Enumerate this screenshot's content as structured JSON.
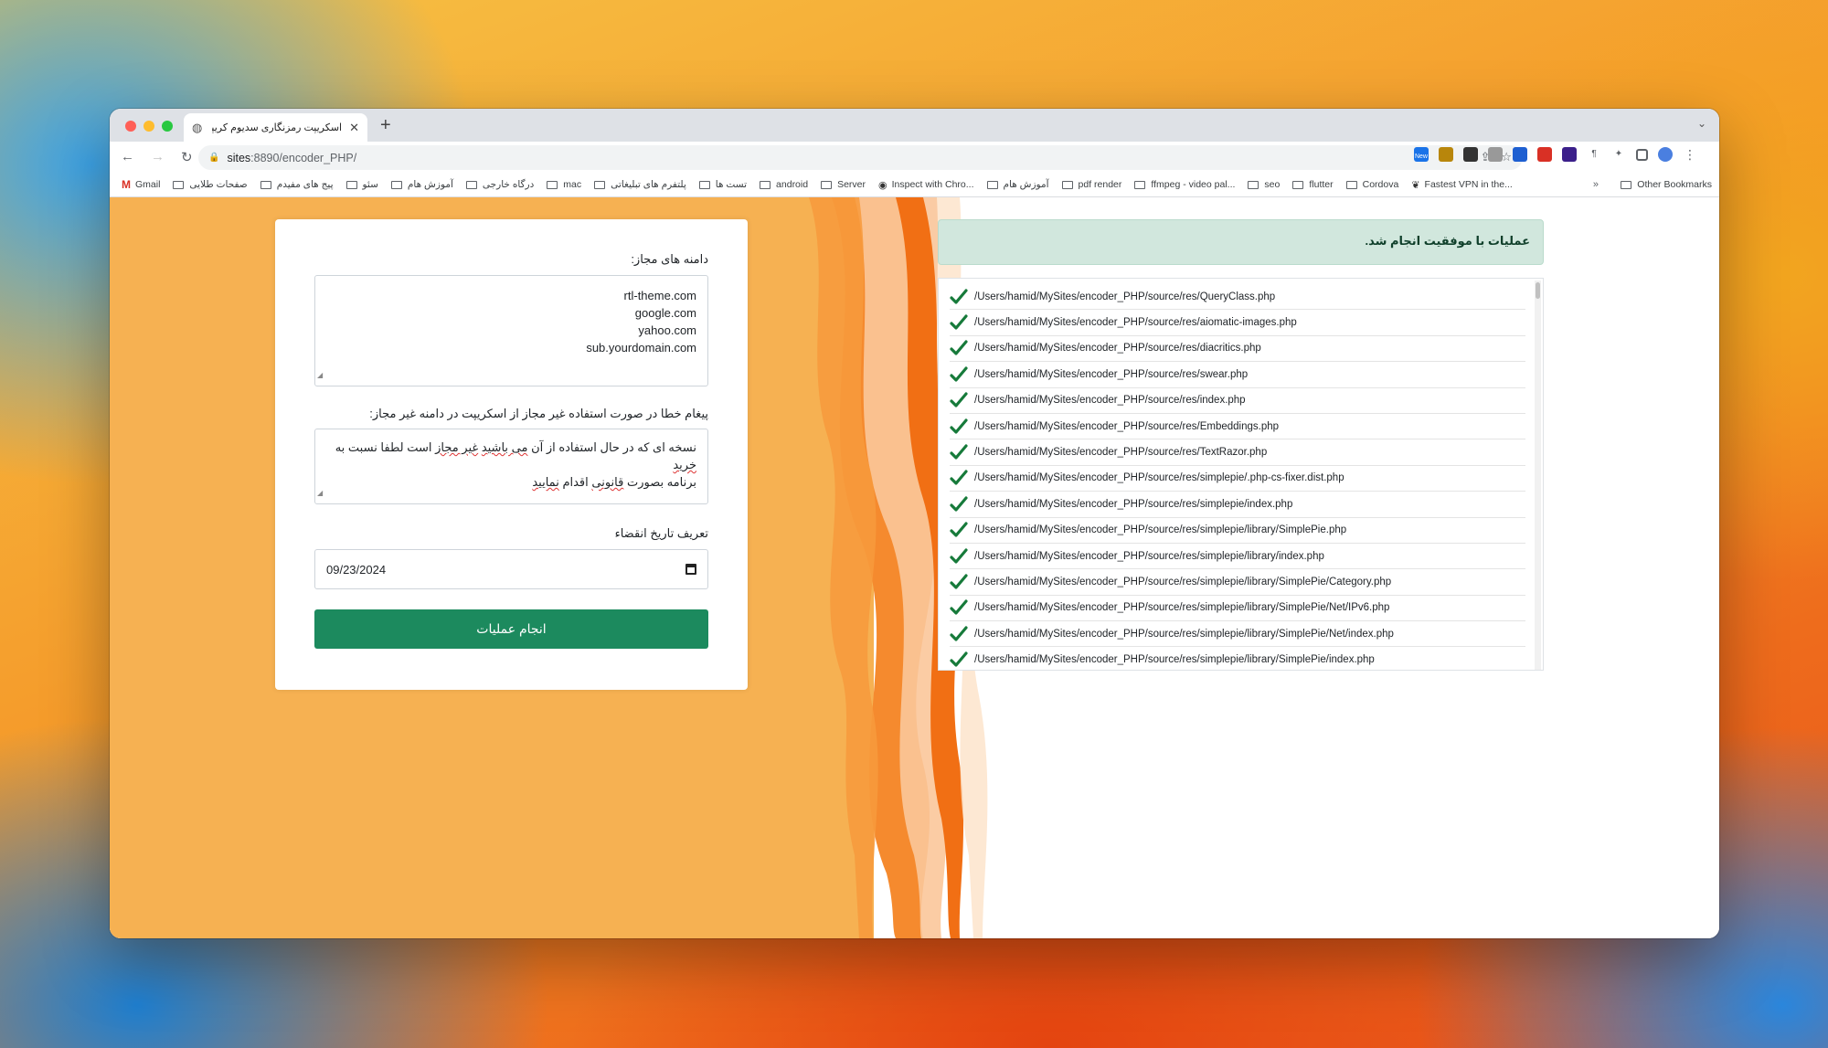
{
  "browser": {
    "tab_title": "اسکریپت رمزنگاری سدیوم کریپتو",
    "url_host": "sites",
    "url_rest": ":8890/encoder_PHP/",
    "bookmarks": [
      "Gmail",
      "صفحات طلایی",
      "پیج های مفیدم",
      "سئو",
      "آموزش هام",
      "درگاه خارجی",
      "mac",
      "پلتفرم های تبلیغاتی",
      "تست ها",
      "android",
      "Server",
      "Inspect with Chro...",
      "آموزش هام",
      "pdf render",
      "ffmpeg - video pal...",
      "seo",
      "flutter",
      "Cordova",
      "Fastest VPN in the..."
    ],
    "bookmarks_more": "»",
    "other_bookmarks": "Other Bookmarks",
    "ext_badge": "New"
  },
  "form": {
    "domains_label": "دامنه های مجاز:",
    "domains": [
      "rtl-theme.com",
      "google.com",
      "yahoo.com",
      "sub.yourdomain.com"
    ],
    "error_label": "پیغام خطا در صورت استفاده غیر مجاز از اسکریپت در دامنه غیر مجاز:",
    "error_line1_a": "نسخه ای که در حال استفاده از آن ",
    "error_line1_u1": "می باشید",
    "error_line1_b": " ",
    "error_line1_u2": "غیر مجاز",
    "error_line1_c": " است لطفا نسبت به ",
    "error_line1_u3": "خرید",
    "error_line2_a": "برنامه بصورت ",
    "error_line2_u1": "قانونی",
    "error_line2_b": " اقدام ",
    "error_line2_u2": "نمایید",
    "expiry_label": "تعریف تاریخ انقضاء",
    "expiry_value": "09/23/2024",
    "submit_label": "انجام عملیات"
  },
  "result": {
    "success_message": "عملیات با موفقیت انجام شد.",
    "files": [
      "/Users/hamid/MySites/encoder_PHP/source/res/QueryClass.php",
      "/Users/hamid/MySites/encoder_PHP/source/res/aiomatic-images.php",
      "/Users/hamid/MySites/encoder_PHP/source/res/diacritics.php",
      "/Users/hamid/MySites/encoder_PHP/source/res/swear.php",
      "/Users/hamid/MySites/encoder_PHP/source/res/index.php",
      "/Users/hamid/MySites/encoder_PHP/source/res/Embeddings.php",
      "/Users/hamid/MySites/encoder_PHP/source/res/TextRazor.php",
      "/Users/hamid/MySites/encoder_PHP/source/res/simplepie/.php-cs-fixer.dist.php",
      "/Users/hamid/MySites/encoder_PHP/source/res/simplepie/index.php",
      "/Users/hamid/MySites/encoder_PHP/source/res/simplepie/library/SimplePie.php",
      "/Users/hamid/MySites/encoder_PHP/source/res/simplepie/library/index.php",
      "/Users/hamid/MySites/encoder_PHP/source/res/simplepie/library/SimplePie/Category.php",
      "/Users/hamid/MySites/encoder_PHP/source/res/simplepie/library/SimplePie/Net/IPv6.php",
      "/Users/hamid/MySites/encoder_PHP/source/res/simplepie/library/SimplePie/Net/index.php",
      "/Users/hamid/MySites/encoder_PHP/source/res/simplepie/library/SimplePie/index.php"
    ]
  },
  "colors": {
    "accent_green": "#1c8a5e",
    "check_green": "#167a3a",
    "page_orange": "#f6b152"
  }
}
